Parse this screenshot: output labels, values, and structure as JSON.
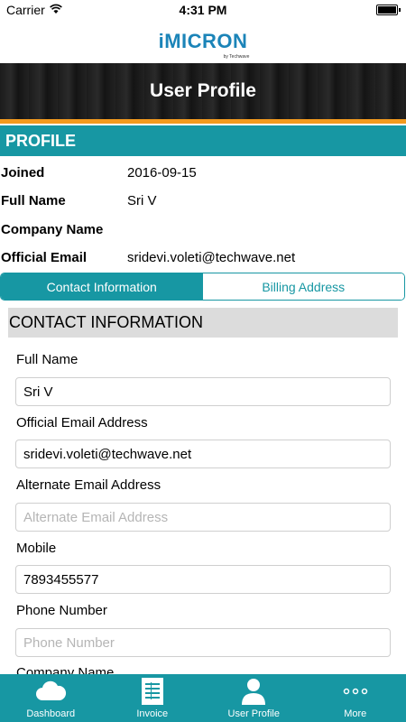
{
  "status_bar": {
    "carrier": "Carrier",
    "time": "4:31 PM"
  },
  "brand": {
    "logo": "iMICRON",
    "sub": "by Techwave"
  },
  "header": {
    "title": "User Profile"
  },
  "profile": {
    "section_title": "PROFILE",
    "rows": [
      {
        "label": "Joined",
        "value": "2016-09-15"
      },
      {
        "label": "Full Name",
        "value": "Sri V"
      },
      {
        "label": "Company Name",
        "value": ""
      },
      {
        "label": "Official Email",
        "value": "sridevi.voleti@techwave.net"
      }
    ]
  },
  "tabs": {
    "contact": "Contact Information",
    "billing": "Billing Address",
    "active": "contact"
  },
  "contact": {
    "section_title": "CONTACT INFORMATION",
    "fields": [
      {
        "label": "Full Name",
        "value": "Sri V",
        "placeholder": ""
      },
      {
        "label": "Official Email Address",
        "value": "sridevi.voleti@techwave.net",
        "placeholder": ""
      },
      {
        "label": "Alternate Email Address",
        "value": "",
        "placeholder": "Alternate Email Address"
      },
      {
        "label": "Mobile",
        "value": "7893455577",
        "placeholder": ""
      },
      {
        "label": "Phone Number",
        "value": "",
        "placeholder": "Phone Number"
      },
      {
        "label": "Company Name"
      }
    ]
  },
  "tabbar": {
    "items": [
      {
        "label": "Dashboard",
        "icon": "cloud-icon"
      },
      {
        "label": "Invoice",
        "icon": "invoice-icon"
      },
      {
        "label": "User Profile",
        "icon": "user-icon"
      },
      {
        "label": "More",
        "icon": "more-dots-icon"
      }
    ]
  },
  "colors": {
    "accent": "#1797a3",
    "stripe": "#f39a1e",
    "logo": "#1b84b8"
  }
}
